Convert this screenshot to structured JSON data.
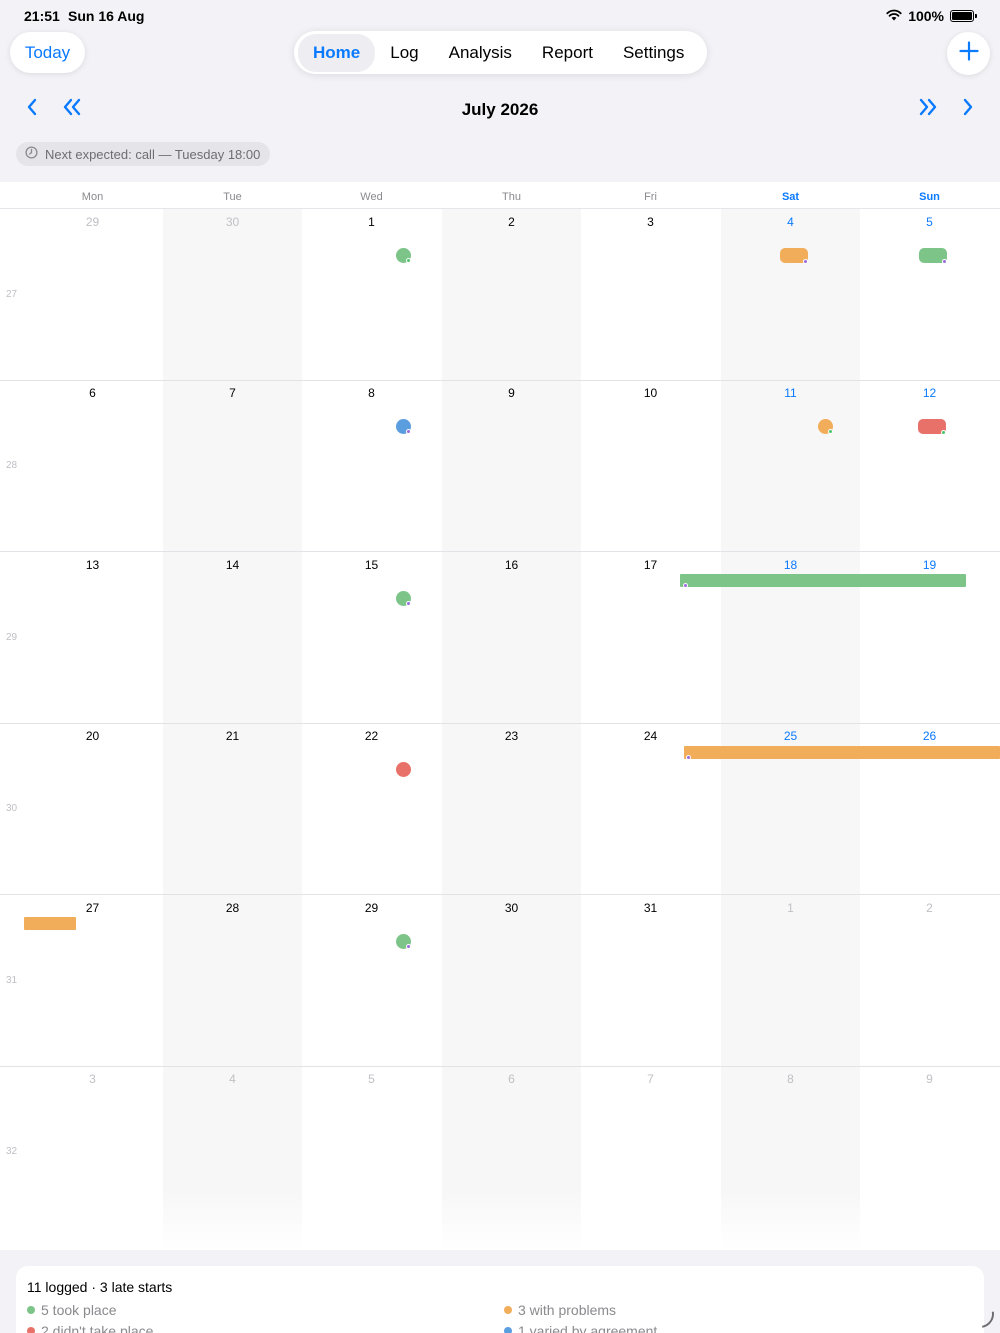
{
  "status": {
    "time": "21:51",
    "date": "Sun 16 Aug",
    "battery": "100%"
  },
  "header": {
    "today_label": "Today",
    "tabs": [
      {
        "label": "Home",
        "active": true
      },
      {
        "label": "Log"
      },
      {
        "label": "Analysis"
      },
      {
        "label": "Report"
      },
      {
        "label": "Settings"
      }
    ],
    "add_icon": "plus-icon"
  },
  "month": {
    "title": "July 2026"
  },
  "next_expected": "Next expected: call — Tuesday 18:00",
  "calendar": {
    "weekdays": [
      "Mon",
      "Tue",
      "Wed",
      "Thu",
      "Fri",
      "Sat",
      "Sun"
    ],
    "weeks": [
      {
        "number": "27",
        "days": [
          "29",
          "30",
          "1",
          "2",
          "3",
          "4",
          "5"
        ]
      },
      {
        "number": "28",
        "days": [
          "6",
          "7",
          "8",
          "9",
          "10",
          "11",
          "12"
        ]
      },
      {
        "number": "29",
        "days": [
          "13",
          "14",
          "15",
          "16",
          "17",
          "18",
          "19"
        ]
      },
      {
        "number": "30",
        "days": [
          "20",
          "21",
          "22",
          "23",
          "24",
          "25",
          "26"
        ]
      },
      {
        "number": "31",
        "days": [
          "27",
          "28",
          "29",
          "30",
          "31",
          "1",
          "2"
        ]
      },
      {
        "number": "32",
        "days": [
          "3",
          "4",
          "5",
          "6",
          "7",
          "8",
          "9"
        ]
      }
    ]
  },
  "colors": {
    "accent": "#0a7aff",
    "took_place": "#7dc488",
    "problems": "#f2ad5a",
    "didnt_take_place": "#e8716a",
    "varied": "#5b9ee0",
    "marker_purple": "#9b6be0",
    "marker_green": "#4cc46a"
  },
  "summary": {
    "title": "11 logged · 3 late starts",
    "legend": [
      {
        "label": "5 took place",
        "color": "#7dc488"
      },
      {
        "label": "3 with problems",
        "color": "#f2ad5a"
      },
      {
        "label": "2 didn't take place",
        "color": "#e8716a"
      },
      {
        "label": "1 varied by agreement",
        "color": "#5b9ee0"
      }
    ]
  }
}
